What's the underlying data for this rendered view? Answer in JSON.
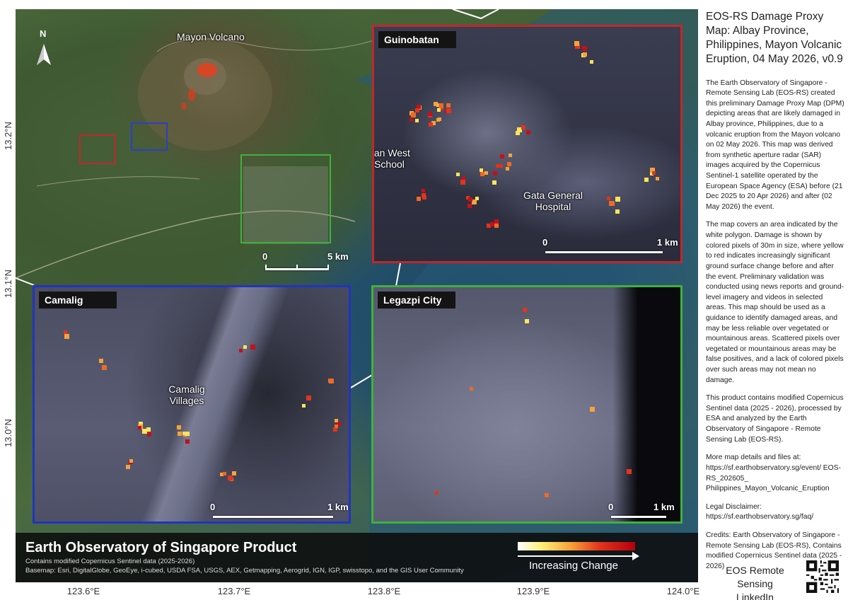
{
  "map": {
    "overview_labels": {
      "volcano": "Mayon Volcano",
      "north": "N"
    },
    "overview_scalebar": {
      "start": "0",
      "end": "5 km"
    },
    "overview_boxes": [
      {
        "name": "camalig",
        "color": "#c0282a"
      },
      {
        "name": "guinobatan",
        "color": "#2d3fc4"
      },
      {
        "name": "legazpi",
        "color": "#3fb23a"
      }
    ],
    "x_ticks": [
      "123.6°E",
      "123.7°E",
      "123.8°E",
      "123.9°E",
      "124.0°E"
    ],
    "y_ticks": [
      "13.2°N",
      "13.1°N",
      "13.0°N"
    ]
  },
  "insets": {
    "guinobatan": {
      "title": "Guinobatan",
      "border_color": "#c0282a",
      "labels": [
        "Guinobatan West Central School",
        "Gata General Hospital"
      ],
      "scalebar": {
        "start": "0",
        "end": "1 km"
      }
    },
    "camalig": {
      "title": "Camalig",
      "border_color": "#2233c2",
      "labels": [
        "Camalig Villages"
      ],
      "scalebar": {
        "start": "0",
        "end": "1 km"
      }
    },
    "legazpi": {
      "title": "Legazpi City",
      "border_color": "#3fb23a",
      "scalebar": {
        "start": "0",
        "end": "1 km"
      }
    }
  },
  "footer": {
    "title": "Earth Observatory of Singapore Product",
    "line1": "Contains modified Copernicus Sentinel data (2025-2026)",
    "line2": "Basemap: Esri, DigitalGlobe, GeoEye, i-cubed, USDA FSA, USGS, AEX, Getmapping, Aerogrid, IGN, IGP, swisstopo, and the GIS User Community",
    "legend_label": "Increasing Change",
    "legend_colors": [
      "#ffffff",
      "#ffef7a",
      "#f7a23a",
      "#e2341c",
      "#b4000f"
    ]
  },
  "panel": {
    "title": "EOS-RS Damage Proxy Map: Albay Province, Philippines, Mayon Volcanic Eruption, 04 May 2026, v0.9",
    "para1": "The Earth Observatory of Singapore - Remote Sensing Lab (EOS-RS) created this preliminary Damage Proxy Map (DPM) depicting areas that are likely damaged in Albay province, Philippines, due to a volcanic eruption from the Mayon volcano on 02 May 2026. This map was derived from synthetic aperture radar (SAR) images acquired by the Copernicus Sentinel-1 satellite operated by the European Space Agency (ESA) before (21 Dec 2025 to 20 Apr 2026) and after (02 May 2026) the event.",
    "para2": "The map covers an area indicated by the white polygon. Damage is shown by colored pixels of 30m in size, where yellow to red indicates increasingly significant ground surface change before and after the event. Preliminary validation was conducted using news reports and ground-level imagery and videos in selected areas. This map should be used as a guidance to identify damaged areas, and may be less reliable over vegetated or mountainous areas. Scattered pixels over vegetated or mountainous areas may be false positives, and a lack of colored pixels over such areas may not mean no damage.",
    "para3": "This product contains modified Copernicus Sentinel data (2025 - 2026), processed by ESA and analyzed by the Earth Observatory of Singapore - Remote Sensing Lab (EOS-RS).",
    "para4": "More map details and files at: https://sf.earthobservatory.sg/event/ EOS-RS_202605_ Philippines_Mayon_Volcanic_Eruption",
    "para5": "Legal Disclaimer: https://sf.earthobservatory.sg/faq/",
    "para6": "Credits: Earth Observatory of Singapore - Remote Sensing Lab (EOS-RS), Contains modified Copernicus Sentinel data (2025 - 2026)",
    "brand_line1": "EOS Remote Sensing",
    "brand_line2": "LinkedIn"
  }
}
